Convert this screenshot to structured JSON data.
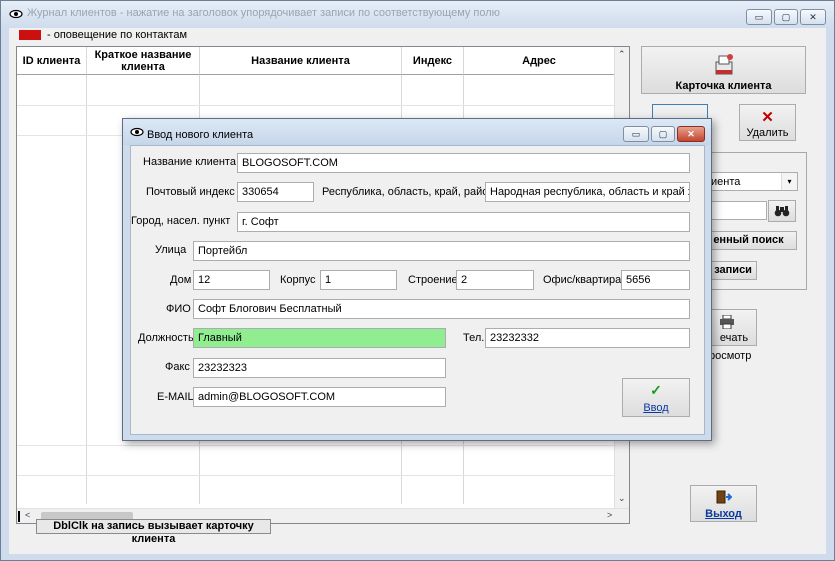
{
  "window": {
    "title": "Журнал клиентов - нажатие на заголовок упорядочивает записи по соответствующему полю",
    "minimize": "▭",
    "maximize": "▢",
    "close": "✕"
  },
  "notice": {
    "label": "- оповещение по контактам",
    "color": "#cc1010"
  },
  "grid": {
    "columns": [
      "ID клиента",
      "Краткое название клиента",
      "Название клиента",
      "Индекс",
      "Адрес"
    ],
    "scroll_left": "<",
    "scroll_right": ">",
    "scroll_down": "⌄"
  },
  "hint": "DblClk на запись вызывает карточку клиента",
  "buttons": {
    "card": "Карточка клиента",
    "delete": "Удалить",
    "delete_icon": "✕",
    "adv_search": "енный поиск",
    "records": "е записи",
    "print": "ечать",
    "preview": "росмотр",
    "exit": "Выход",
    "find_icon": "binoculars-icon"
  },
  "search": {
    "combo_value": "иента",
    "combo_arrow": "▾"
  },
  "dialog": {
    "title": "Ввод нового клиента",
    "fields": {
      "client_name": {
        "label": "Название клиента",
        "value": "BLOGOSOFT.COM"
      },
      "postal_index": {
        "label": "Почтовый индекс",
        "value": "330654"
      },
      "region": {
        "label": "Республика, область, край, район",
        "value": "Народная республика, область и край хор"
      },
      "city": {
        "label": "Город, насел. пункт",
        "value": "г. Софт"
      },
      "street": {
        "label": "Улица",
        "value": "Портейбл"
      },
      "house": {
        "label": "Дом",
        "value": "12"
      },
      "korpus": {
        "label": "Корпус",
        "value": "1"
      },
      "building": {
        "label": "Строение",
        "value": "2"
      },
      "office": {
        "label": "Офис/квартира",
        "value": "5656"
      },
      "fio": {
        "label": "ФИО",
        "value": "Софт Блогович Бесплатный"
      },
      "position": {
        "label": "Должность",
        "value": "Главный"
      },
      "phone": {
        "label": "Тел.",
        "value": "23232332"
      },
      "fax": {
        "label": "Факс",
        "value": "23232323"
      },
      "email": {
        "label": "E-MAIL",
        "value": "admin@BLOGOSOFT.COM"
      }
    },
    "enter_button": "Ввод",
    "enter_icon": "✓"
  }
}
